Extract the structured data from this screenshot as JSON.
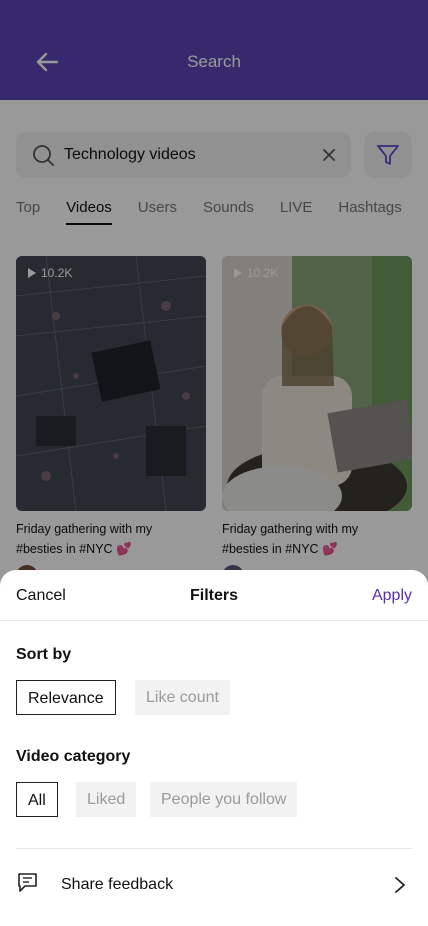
{
  "header": {
    "title": "Search"
  },
  "search": {
    "query": "Technology videos"
  },
  "tabs": [
    {
      "label": "Top"
    },
    {
      "label": "Videos"
    },
    {
      "label": "Users"
    },
    {
      "label": "Sounds"
    },
    {
      "label": "LIVE"
    },
    {
      "label": "Hashtags"
    }
  ],
  "active_tab": "Videos",
  "videos": [
    {
      "views": "10.2K",
      "caption_line1": "Friday gathering with my",
      "caption_line2": "#besties in #NYC 💕"
    },
    {
      "views": "10.2K",
      "caption_line1": "Friday gathering with my",
      "caption_line2": "#besties in #NYC 💕"
    }
  ],
  "sheet": {
    "cancel_label": "Cancel",
    "title": "Filters",
    "apply_label": "Apply",
    "sort_by": {
      "label": "Sort by",
      "options": [
        "Relevance",
        "Like count"
      ],
      "selected": "Relevance"
    },
    "video_category": {
      "label": "Video category",
      "options": [
        "All",
        "Liked",
        "People you follow"
      ],
      "selected": "All"
    },
    "feedback_label": "Share feedback"
  },
  "colors": {
    "header_bg": "#5a46b6",
    "apply": "#5a2fa7",
    "scrim": "rgba(0,0,0,0.4)"
  }
}
